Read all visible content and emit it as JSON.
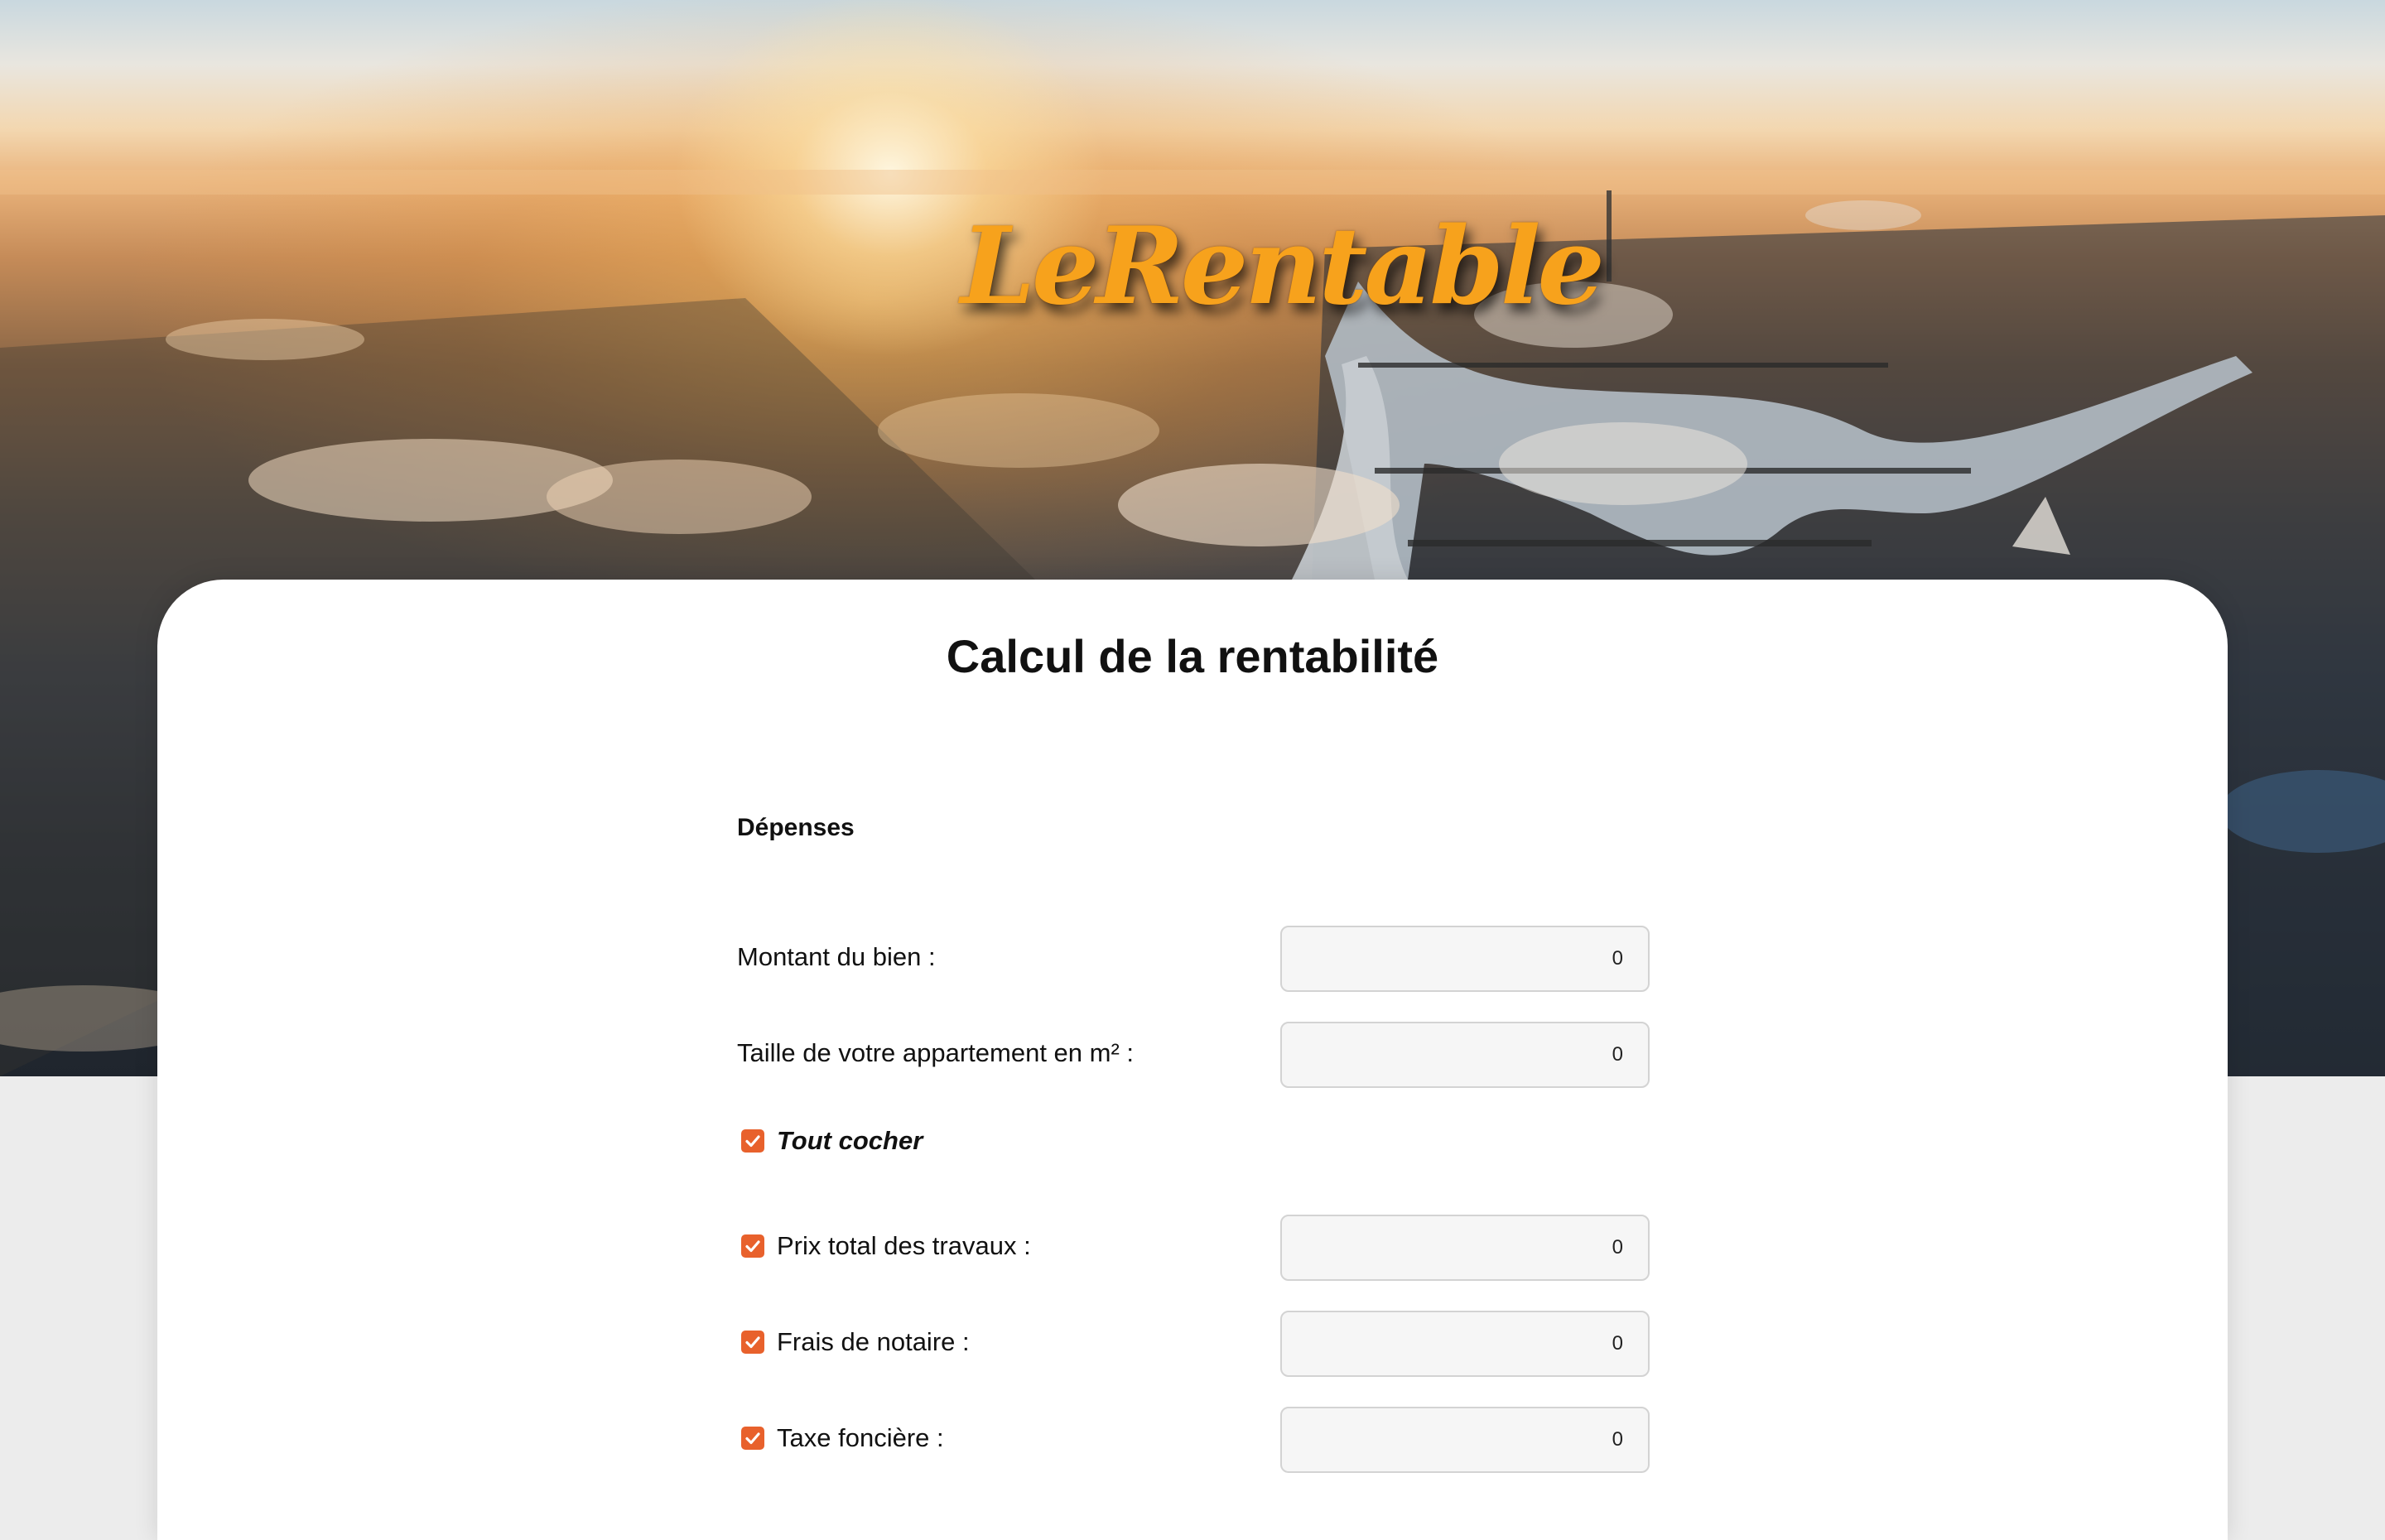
{
  "header": {
    "logo_text": "LeRentable"
  },
  "form": {
    "title": "Calcul de la rentabilité",
    "section_expenses": "Dépenses",
    "amount_label": "Montant du bien :",
    "amount_value": "0",
    "size_label": "Taille de votre appartement en m² :",
    "size_value": "0",
    "check_all_label": "Tout cocher",
    "check_all_checked": true,
    "works_label": "Prix total des travaux :",
    "works_value": "0",
    "works_checked": true,
    "notary_label": "Frais de notaire :",
    "notary_value": "0",
    "notary_checked": true,
    "property_tax_label": "Taxe foncière :",
    "property_tax_value": "0",
    "property_tax_checked": true
  },
  "colors": {
    "accent": "#e8612c",
    "logo": "#f7a21c",
    "page_bg": "#ececec"
  }
}
